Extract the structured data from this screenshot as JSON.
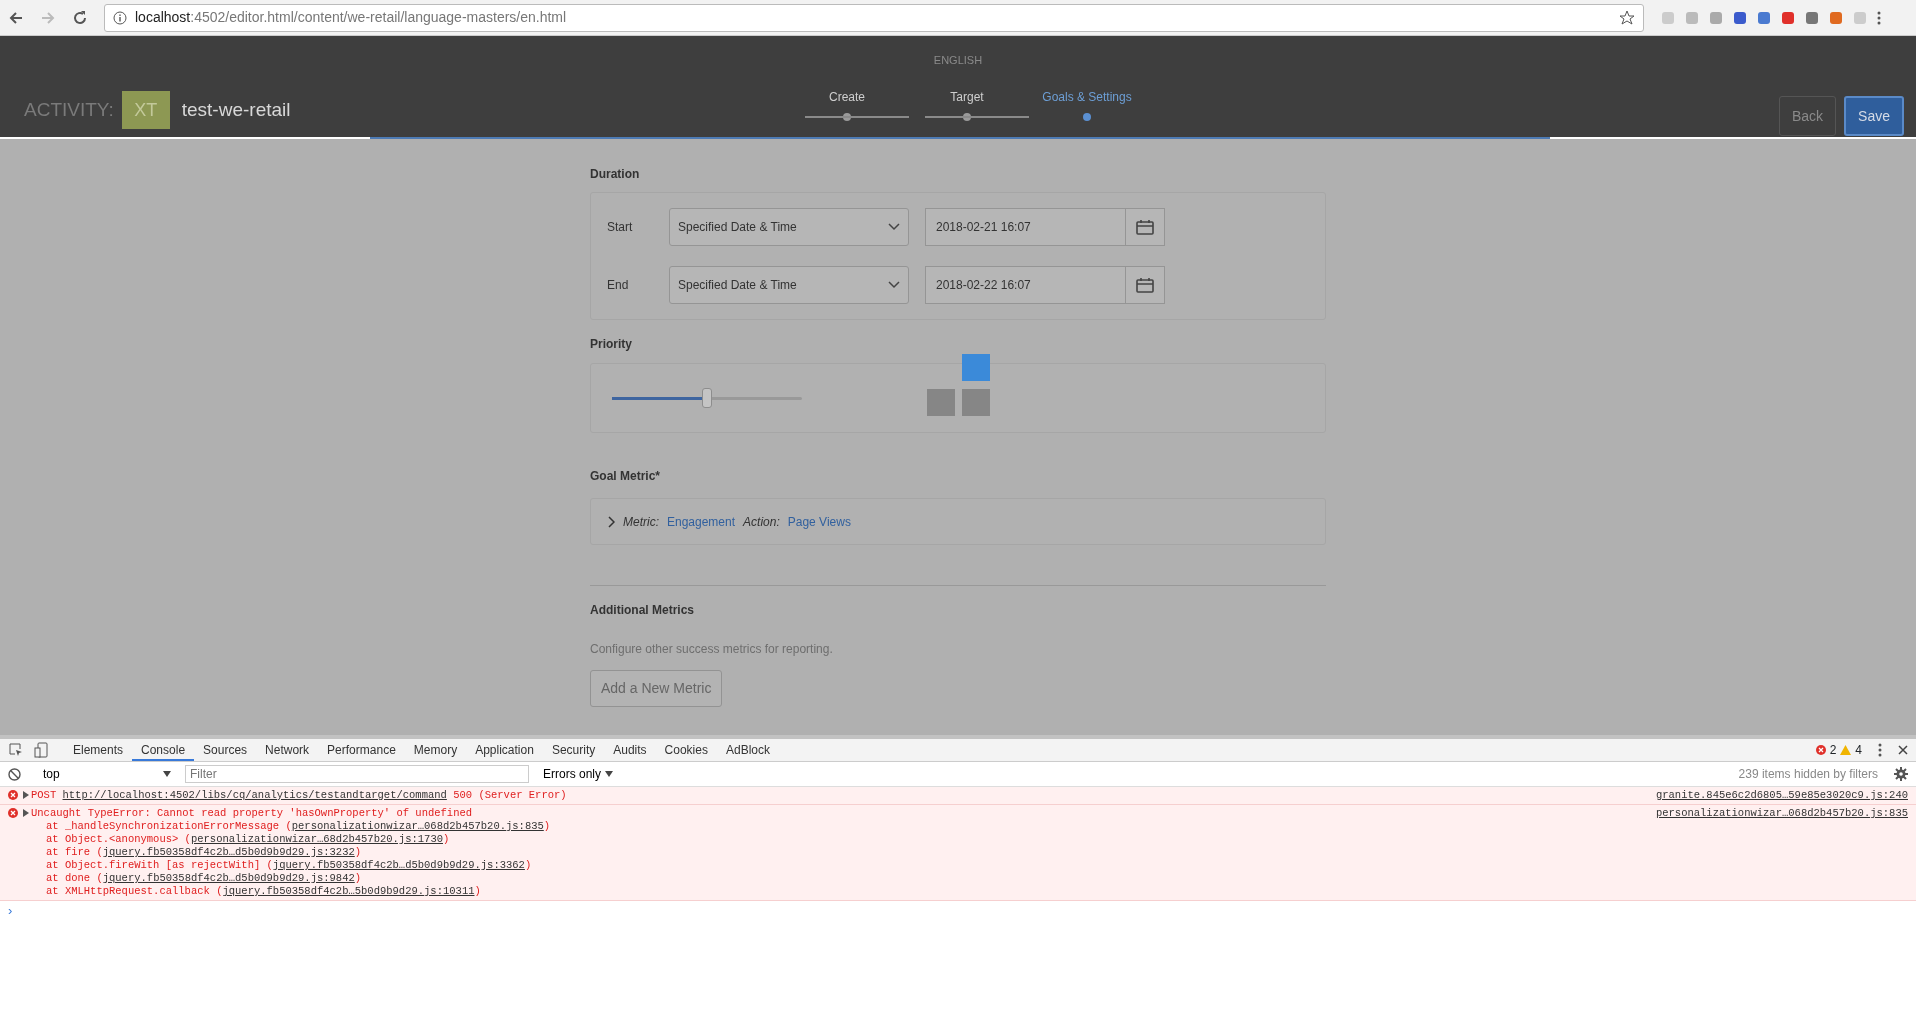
{
  "browser": {
    "url_host": "localhost",
    "url_path": ":4502/editor.html/content/we-retail/language-masters/en.html"
  },
  "header": {
    "language": "ENGLISH",
    "activity_label": "ACTIVITY:",
    "activity_badge": "XT",
    "activity_name": "test-we-retail",
    "steps": [
      {
        "label": "Create",
        "selected": false
      },
      {
        "label": "Target",
        "selected": false
      },
      {
        "label": "Goals & Settings",
        "selected": true
      }
    ],
    "buttons": [
      {
        "label": "Back",
        "kind": "secondary"
      },
      {
        "label": "Save",
        "kind": "primary"
      }
    ]
  },
  "duration": {
    "title": "Duration",
    "rows": [
      {
        "label": "Start",
        "select": "Specified Date & Time",
        "date": "2018-02-21 16:07"
      },
      {
        "label": "End",
        "select": "Specified Date & Time",
        "date": "2018-02-22 16:07"
      }
    ]
  },
  "priority": {
    "title": "Priority",
    "level": 0.5
  },
  "goal_metric": {
    "title": "Goal Metric*",
    "expanded": false,
    "metric_label": "Metric:",
    "metric_value": "Engagement",
    "action_label": "Action:",
    "action_value": "Page Views"
  },
  "additional_metrics": {
    "title": "Additional Metrics",
    "description": "Configure other success metrics for reporting.",
    "button": "Add a New Metric"
  },
  "devtools": {
    "tabs": [
      {
        "label": "Elements",
        "selected": false
      },
      {
        "label": "Console",
        "selected": true
      },
      {
        "label": "Sources",
        "selected": false
      },
      {
        "label": "Network",
        "selected": false
      },
      {
        "label": "Performance",
        "selected": false
      },
      {
        "label": "Memory",
        "selected": false
      },
      {
        "label": "Application",
        "selected": false
      },
      {
        "label": "Security",
        "selected": false
      },
      {
        "label": "Audits",
        "selected": false
      },
      {
        "label": "Cookies",
        "selected": false
      },
      {
        "label": "AdBlock",
        "selected": false
      }
    ],
    "error_count": "2",
    "warning_count": "4",
    "context": "top",
    "filter_placeholder": "Filter",
    "levels": "Errors only",
    "hidden_note": "239 items hidden by filters",
    "messages": [
      {
        "expanded": false,
        "before": "POST ",
        "link": "http://localhost:4502/libs/cq/analytics/testandtarget/command",
        "after": " 500 (Server Error)",
        "source": "granite.845e6c2d6805…59e85e3020c9.js:240"
      },
      {
        "expanded": false,
        "before": "Uncaught TypeError: Cannot read property 'hasOwnProperty' of undefined",
        "source": "personalizationwizar…068d2b457b20.js:835",
        "stack": [
          {
            "before": "at _handleSynchronizationErrorMessage (",
            "link": "personalizationwizar…068d2b457b20.js:835",
            "after": ")"
          },
          {
            "before": "at Object.<anonymous> (",
            "link": "personalizationwizar…68d2b457b20.js:1730",
            "after": ")"
          },
          {
            "before": "at fire (",
            "link": "jquery.fb50358df4c2b…d5b0d9b9d29.js:3232",
            "after": ")"
          },
          {
            "before": "at Object.fireWith [as rejectWith] (",
            "link": "jquery.fb50358df4c2b…d5b0d9b9d29.js:3362",
            "after": ")"
          },
          {
            "before": "at done (",
            "link": "jquery.fb50358df4c2b…d5b0d9b9d29.js:9842",
            "after": ")"
          },
          {
            "before": "at XMLHttpRequest.callback (",
            "link": "jquery.fb50358df4c2b…5b0d9b9d29.js:10311",
            "after": ")"
          }
        ]
      }
    ],
    "prompt": "›"
  }
}
